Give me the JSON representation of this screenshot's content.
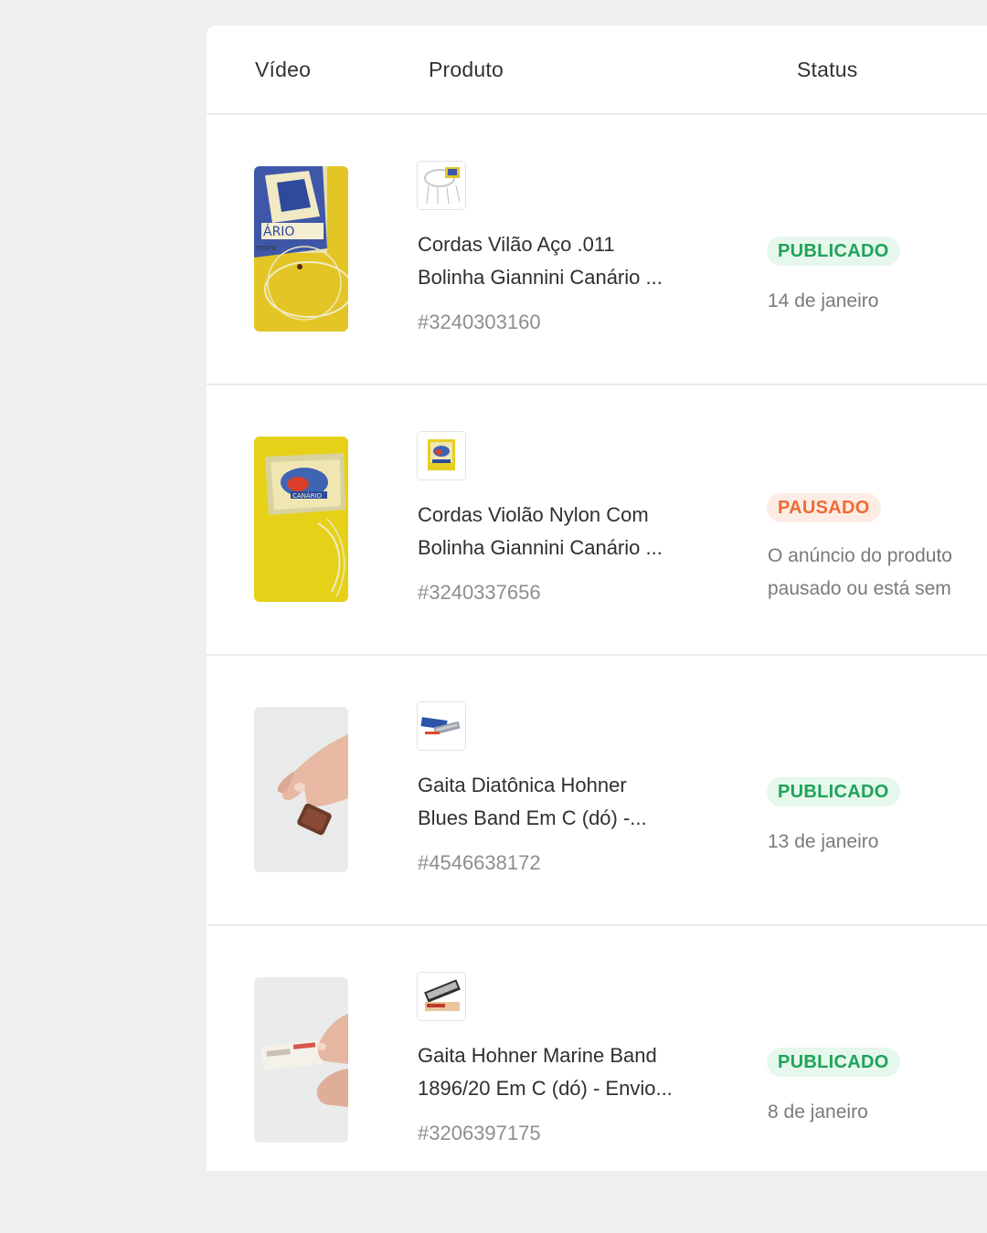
{
  "table": {
    "headers": {
      "video": "Vídeo",
      "produto": "Produto",
      "status": "Status"
    },
    "rows": [
      {
        "product_name_line1": "Cordas Vilão Aço .011",
        "product_name_line2": "Bolinha Giannini Canário ...",
        "product_id": "#3240303160",
        "status": "PUBLICADO",
        "status_line1": "14 de janeiro",
        "status_line2": ""
      },
      {
        "product_name_line1": "Cordas Violão Nylon Com",
        "product_name_line2": "Bolinha Giannini Canário ...",
        "product_id": "#3240337656",
        "status": "PAUSADO",
        "status_line1": "O anúncio do produto",
        "status_line2": "pausado ou está sem"
      },
      {
        "product_name_line1": "Gaita Diatônica Hohner",
        "product_name_line2": "Blues Band Em C (dó) -...",
        "product_id": "#4546638172",
        "status": "PUBLICADO",
        "status_line1": "13 de janeiro",
        "status_line2": ""
      },
      {
        "product_name_line1": "Gaita Hohner Marine Band",
        "product_name_line2": "1896/20 Em C (dó) - Envio...",
        "product_id": "#3206397175",
        "status": "PUBLICADO",
        "status_line1": "8 de janeiro",
        "status_line2": ""
      }
    ]
  },
  "colors": {
    "published_text": "#1ea35a",
    "published_bg": "#e6f7ec",
    "paused_text": "#ef6b36",
    "paused_bg": "#fdece4"
  }
}
